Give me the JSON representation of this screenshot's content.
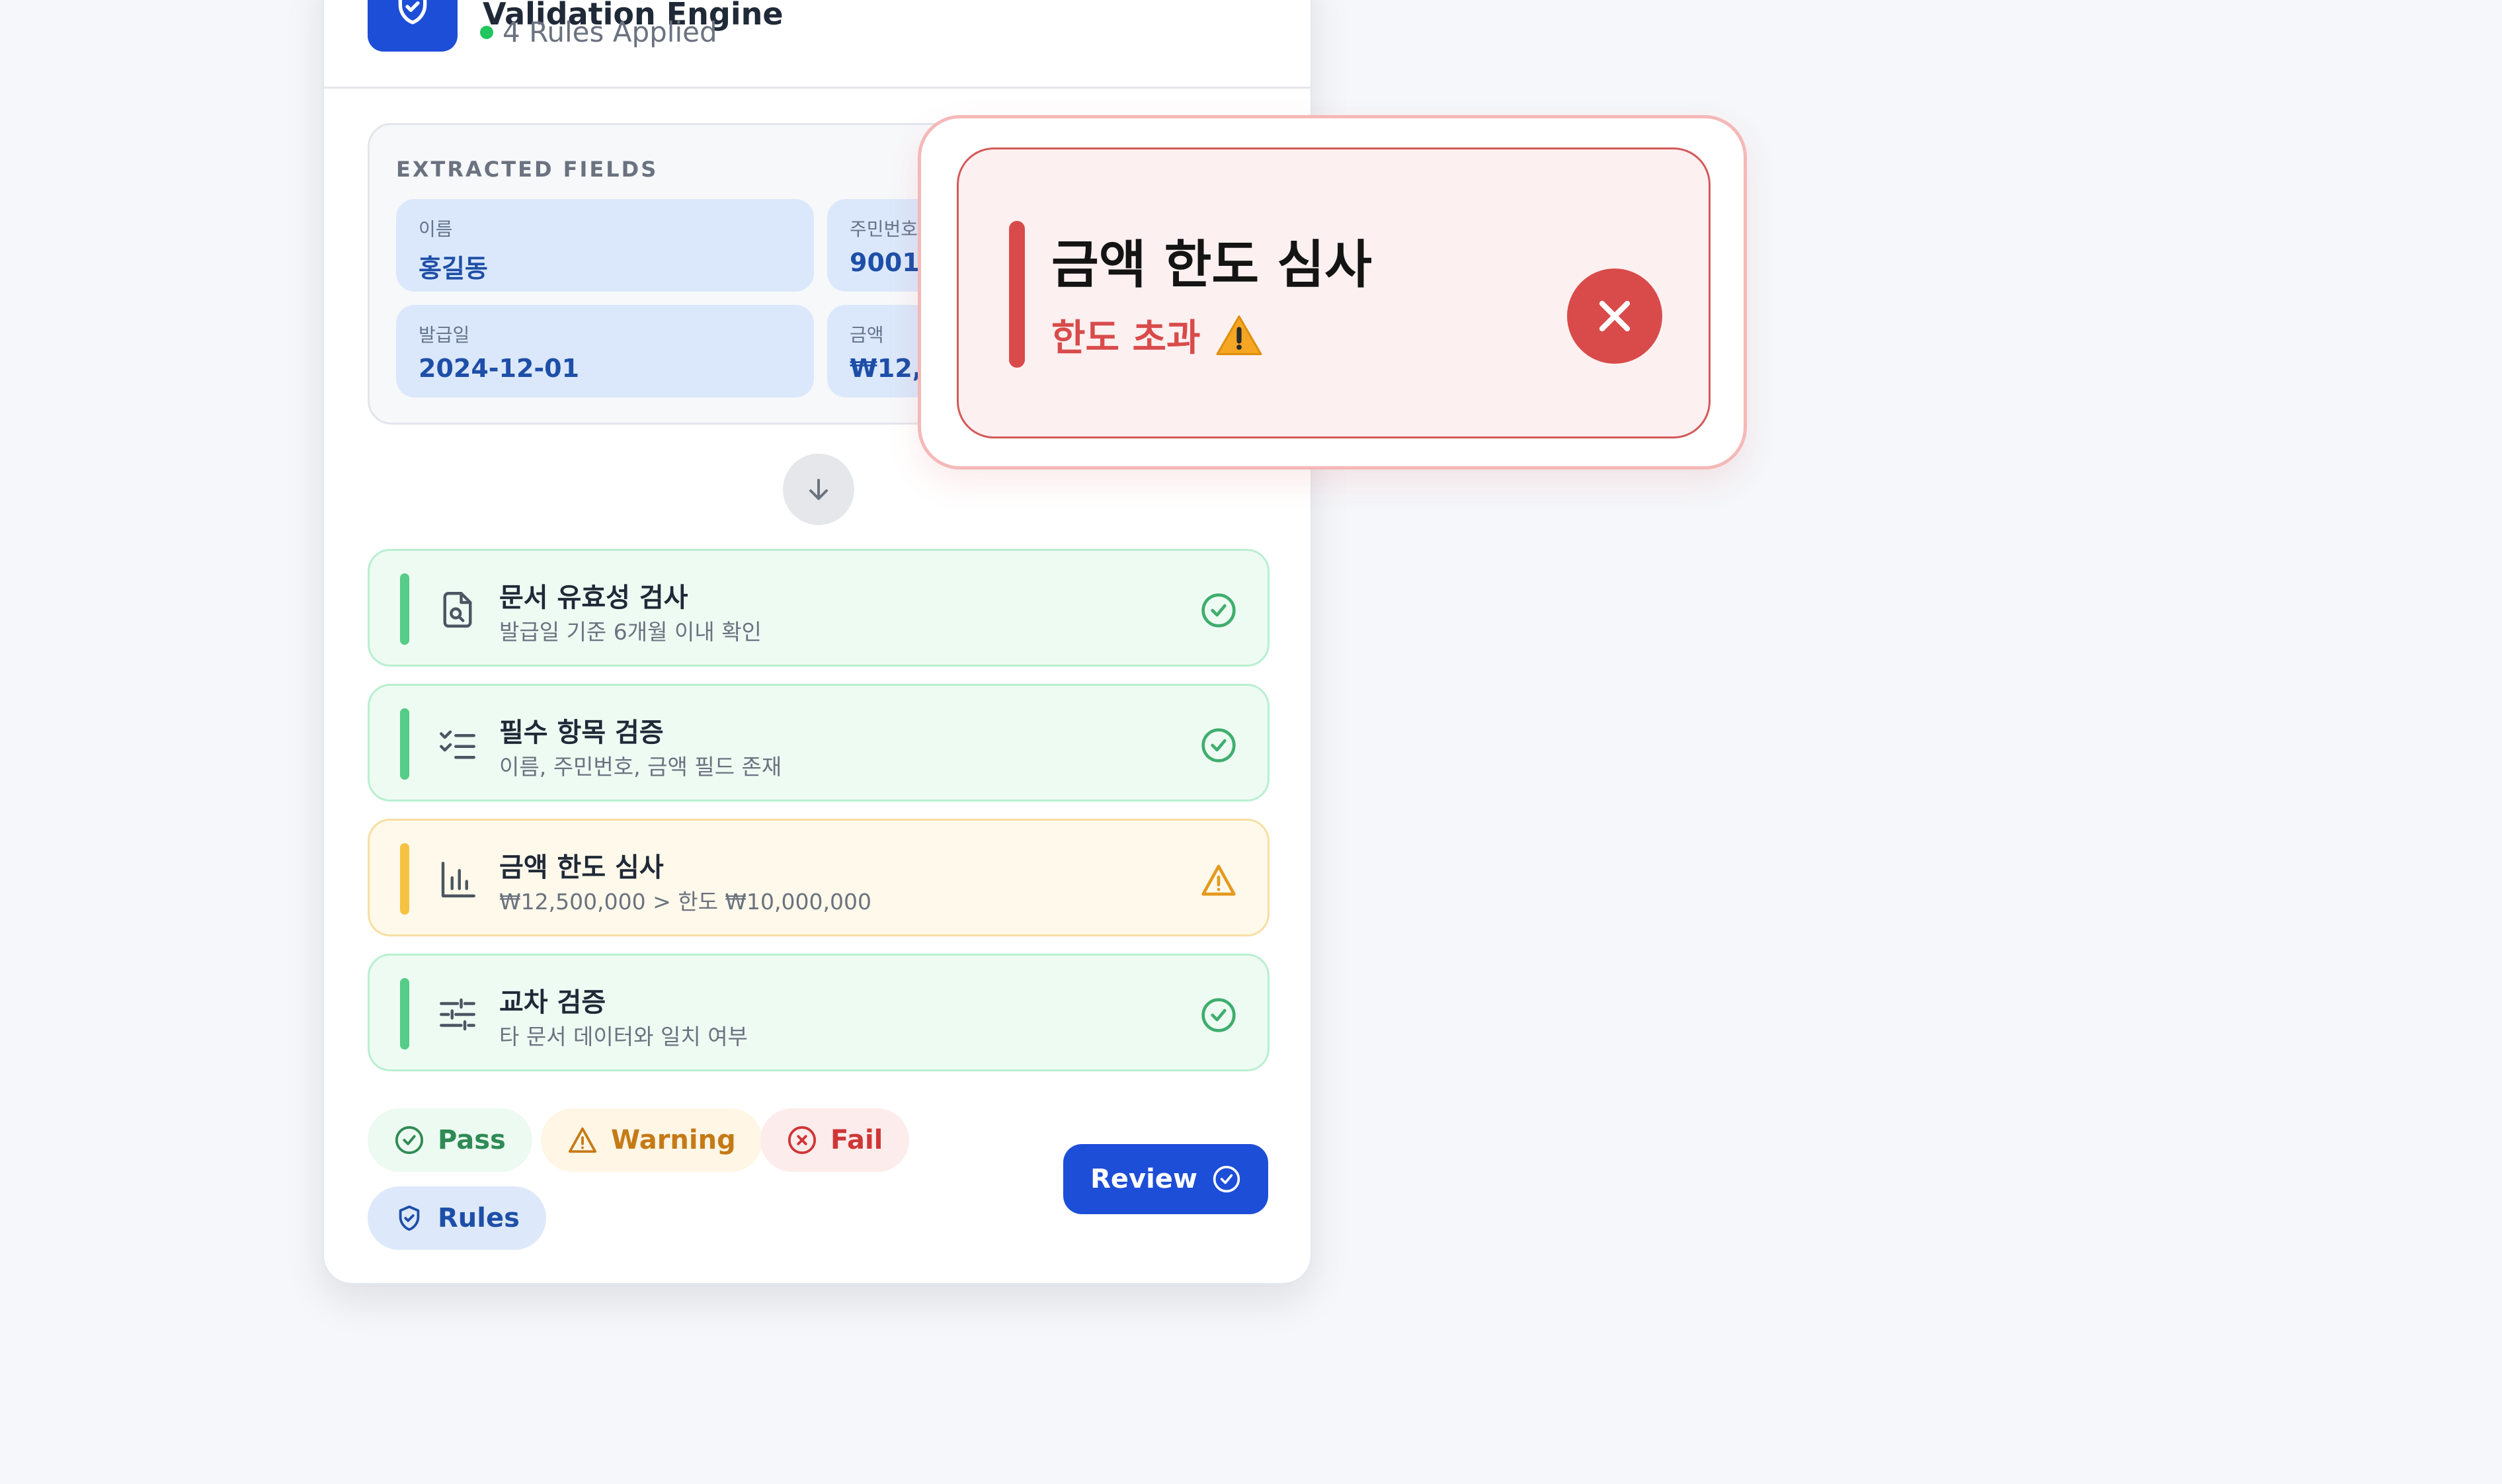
{
  "header": {
    "title": "Validation Engine",
    "subtitle": "4 Rules Applied"
  },
  "extracted": {
    "title": "EXTRACTED FIELDS",
    "fields": [
      {
        "label": "이름",
        "value": "홍길동"
      },
      {
        "label": "주민번호",
        "value": "900101-1******"
      },
      {
        "label": "발급일",
        "value": "2024-12-01"
      },
      {
        "label": "금액",
        "value": "₩12,500,000"
      }
    ]
  },
  "rules": [
    {
      "title": "문서 유효성 검사",
      "desc": "발급일 기준 6개월 이내 확인",
      "status": "pass",
      "icon": "document-search-icon"
    },
    {
      "title": "필수 항목 검증",
      "desc": "이름, 주민번호, 금액 필드 존재",
      "status": "pass",
      "icon": "checklist-icon"
    },
    {
      "title": "금액 한도 심사",
      "desc": "₩12,500,000 > 한도 ₩10,000,000",
      "status": "warning",
      "icon": "bar-chart-icon"
    },
    {
      "title": "교차 검증",
      "desc": "타 문서 데이터와 일치 여부",
      "status": "pass",
      "icon": "sliders-icon"
    }
  ],
  "chips": {
    "pass": "Pass",
    "warning": "Warning",
    "fail": "Fail",
    "rules": "Rules"
  },
  "review_button": "Review",
  "popup": {
    "title": "금액 한도 심사",
    "subtitle": "한도 초과"
  },
  "colors": {
    "primary": "#1d4ed8",
    "pass": "#55cc87",
    "warning": "#f5c242",
    "fail": "#d94b4b"
  }
}
